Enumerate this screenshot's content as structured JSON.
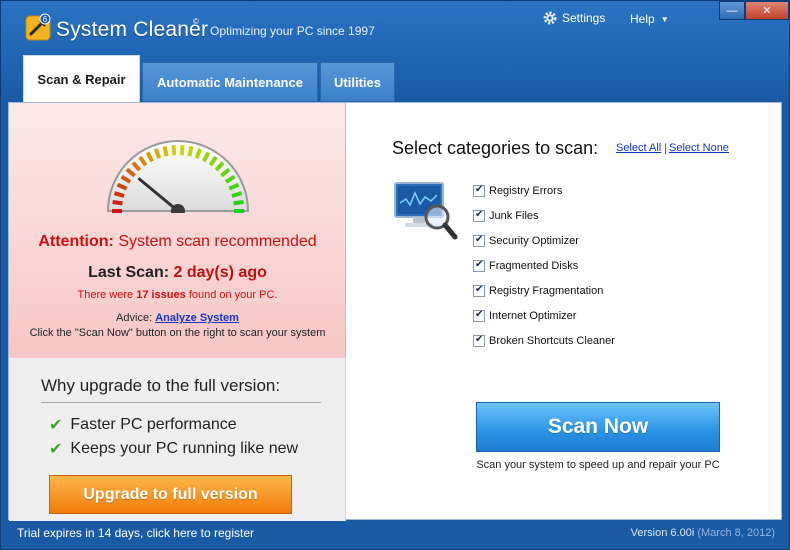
{
  "app": {
    "title": "System Cleaner",
    "reg_mark": "©",
    "tagline": "Optimizing your PC since 1997",
    "logo_badge": "6"
  },
  "header": {
    "settings_label": "Settings",
    "help_label": "Help"
  },
  "window_controls": {
    "minimize": "—",
    "close": "✕"
  },
  "tabs": [
    {
      "label": "Scan & Repair",
      "active": true
    },
    {
      "label": "Automatic Maintenance",
      "active": false
    },
    {
      "label": "Utilities",
      "active": false
    }
  ],
  "status": {
    "attention_label": "Attention:",
    "attention_text": "System scan recommended",
    "last_scan_label": "Last Scan:",
    "last_scan_value": "2 day(s) ago",
    "issues_prefix": "There were",
    "issues_count": "17 issues",
    "issues_suffix": "found on your PC.",
    "advice_label": "Advice:",
    "advice_link": "Analyze System",
    "advice_text": "Click the \"Scan Now\" button on the right to scan your system",
    "gauge_level": 0.22
  },
  "upgrade": {
    "heading": "Why upgrade to the full version:",
    "benefits": [
      "Faster PC performance",
      "Keeps your PC running like new"
    ],
    "button_label": "Upgrade to full version"
  },
  "scan": {
    "title": "Select categories to scan:",
    "select_all": "Select All",
    "separator": "|",
    "select_none": "Select None",
    "categories": [
      {
        "label": "Registry Errors",
        "checked": true
      },
      {
        "label": "Junk Files",
        "checked": true
      },
      {
        "label": "Security Optimizer",
        "checked": true
      },
      {
        "label": "Fragmented Disks",
        "checked": true
      },
      {
        "label": "Registry Fragmentation",
        "checked": true
      },
      {
        "label": "Internet Optimizer",
        "checked": true
      },
      {
        "label": "Broken Shortcuts Cleaner",
        "checked": true
      }
    ],
    "button_label": "Scan Now",
    "hint": "Scan your system to speed up and repair your PC"
  },
  "footer": {
    "trial_text": "Trial expires in 14 days, click here to register",
    "version": "Version 6.00i",
    "version_date": "(March 8, 2012)"
  },
  "colors": {
    "title_bar": "#1f64b2",
    "attention_red": "#d01010",
    "upgrade_orange": "#f07d0a",
    "scan_blue": "#2a91e3",
    "link_blue": "#1336c9"
  }
}
